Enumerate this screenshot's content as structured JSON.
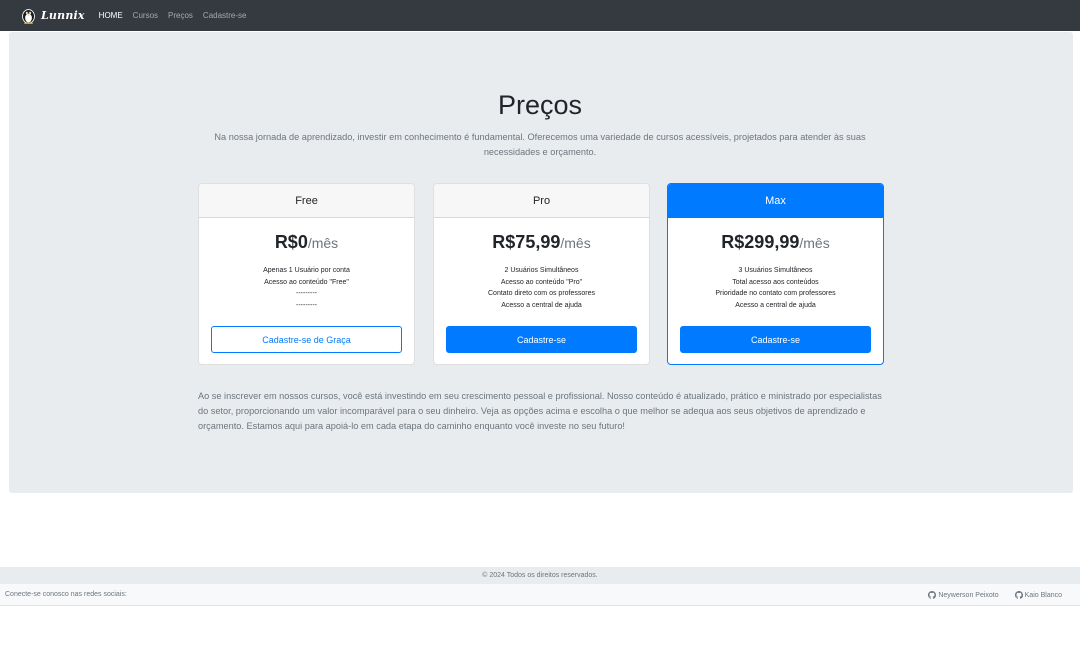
{
  "nav": {
    "brand": "Lunnix",
    "items": [
      {
        "label": "HOME",
        "active": true
      },
      {
        "label": "Cursos",
        "active": false
      },
      {
        "label": "Preços",
        "active": false
      },
      {
        "label": "Cadastre-se",
        "active": false
      }
    ]
  },
  "hero": {
    "title": "Preços",
    "lead": "Na nossa jornada de aprendizado, investir em conhecimento é fundamental. Oferecemos uma variedade de cursos acessíveis, projetados para atender às suas necessidades e orçamento."
  },
  "plans": [
    {
      "name": "Free",
      "price": "R$0",
      "period": "/mês",
      "features": [
        "Apenas 1 Usuário por conta",
        "Acesso ao conteúdo \"Free\"",
        "---------",
        "---------"
      ],
      "button": "Cadastre-se de Graça"
    },
    {
      "name": "Pro",
      "price": "R$75,99",
      "period": "/mês",
      "features": [
        "2 Usuários Simultâneos",
        "Acesso ao conteúdo \"Pro\"",
        "Contato direto com os professores",
        "Acesso a central de ajuda"
      ],
      "button": "Cadastre-se"
    },
    {
      "name": "Max",
      "price": "R$299,99",
      "period": "/mês",
      "features": [
        "3 Usuários Simultâneos",
        "Total acesso aos conteúdos",
        "Prioridade no contato com professores",
        "Acesso a central de ajuda"
      ],
      "button": "Cadastre-se"
    }
  ],
  "bottom_text": "Ao se inscrever em nossos cursos, você está investindo em seu crescimento pessoal e profissional. Nosso conteúdo é atualizado, prático e ministrado por especialistas do setor, proporcionando um valor incomparável para o seu dinheiro. Veja as opções acima e escolha o que melhor se adequa aos seus objetivos de aprendizado e orçamento. Estamos aqui para apoiá-lo em cada etapa do caminho enquanto você investe no seu futuro!",
  "footer": {
    "copyright": "© 2024 Todos os direitos reservados.",
    "social_text": "Conecte-se conosco nas redes sociais:",
    "links": [
      {
        "label": "Neywerson Peixoto",
        "icon": "github-icon"
      },
      {
        "label": "Kaio Blanco",
        "icon": "github-icon"
      }
    ]
  },
  "colors": {
    "navbar": "#343a40",
    "primary": "#007bff",
    "jumbotron": "#e9ecef",
    "muted": "#6c757d"
  }
}
